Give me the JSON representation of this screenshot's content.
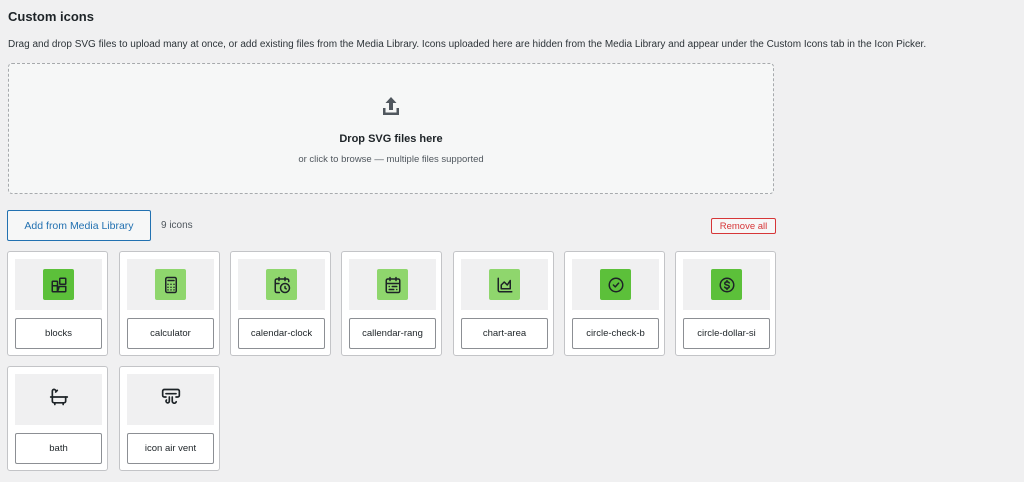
{
  "header": {
    "title": "Custom icons",
    "description": "Drag and drop SVG files to upload many at once, or add existing files from the Media Library. Icons uploaded here are hidden from the Media Library and appear under the Custom Icons tab in the Icon Picker."
  },
  "dropzone": {
    "icon": "upload-icon",
    "title": "Drop SVG files here",
    "subtitle": "or click to browse — multiple files supported"
  },
  "toolbar": {
    "add_label": "Add from Media Library",
    "count_label": "9 icons",
    "remove_label": "Remove all"
  },
  "colors": {
    "accent": "#2271b1",
    "danger": "#d63638",
    "icon_green": "#5cc03a",
    "icon_light_green": "#8fd66d"
  },
  "icons": [
    {
      "name": "blocks",
      "icon": "blocks-icon"
    },
    {
      "name": "calculator",
      "icon": "calculator-icon"
    },
    {
      "name": "calendar-clock",
      "icon": "calendar-clock-icon"
    },
    {
      "name": "callendar-rang",
      "icon": "calendar-range-icon"
    },
    {
      "name": "chart-area",
      "icon": "chart-area-icon"
    },
    {
      "name": "circle-check-b",
      "icon": "circle-check-icon"
    },
    {
      "name": "circle-dollar-si",
      "icon": "circle-dollar-icon"
    },
    {
      "name": "bath",
      "icon": "bath-icon"
    },
    {
      "name": "icon air vent",
      "icon": "air-vent-icon"
    }
  ]
}
